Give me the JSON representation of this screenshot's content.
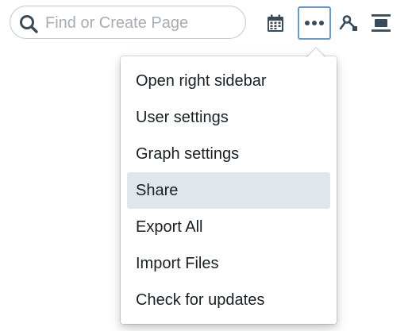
{
  "search": {
    "placeholder": "Find or Create Page",
    "icon": "search-icon"
  },
  "toolbar": {
    "buttons": [
      {
        "name": "daily-notes-button",
        "icon": "calendar-icon"
      },
      {
        "name": "more-button",
        "icon": "more-horizontal-icon",
        "active": true
      },
      {
        "name": "graph-overview-button",
        "icon": "graph-icon"
      },
      {
        "name": "right-sidebar-button",
        "icon": "sidebar-icon"
      }
    ]
  },
  "menu": {
    "items": [
      {
        "label": "Open right sidebar"
      },
      {
        "label": "User settings"
      },
      {
        "label": "Graph settings"
      },
      {
        "label": "Share",
        "highlighted": true
      },
      {
        "label": "Export All"
      },
      {
        "label": "Import Files"
      },
      {
        "label": "Check for updates"
      }
    ]
  },
  "colors": {
    "icon": "#394b59",
    "active_border": "#6c98c4",
    "highlight_bg": "#e1e6ea",
    "text": "#182026",
    "placeholder": "#a6adb4"
  }
}
